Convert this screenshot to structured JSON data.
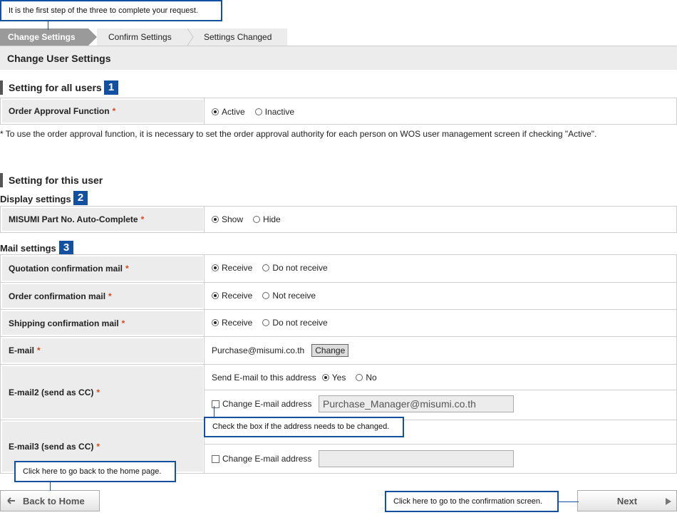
{
  "callouts": {
    "step": "It is the first step of the three to complete your request.",
    "checkbox": "Check the box if the address needs to be changed.",
    "home": "Click here to go back to the home page.",
    "next": "Click here to go to the confirmation screen."
  },
  "steps": [
    "Change Settings",
    "Confirm Settings",
    "Settings Changed"
  ],
  "page_title": "Change User Settings",
  "sections": {
    "all_users": {
      "title": "Setting for all users",
      "num": "1"
    },
    "this_user": {
      "title": "Setting for this user"
    },
    "display": {
      "title": "Display settings",
      "num": "2"
    },
    "mail": {
      "title": "Mail settings",
      "num": "3"
    }
  },
  "required_mark": "*",
  "order_approval": {
    "label": "Order Approval Function",
    "opt1": "Active",
    "opt2": "Inactive"
  },
  "note": "* To use the order approval function, it is necessary to set the order approval authority for each person on WOS user management screen if checking \"Active\".",
  "autocomplete": {
    "label": "MISUMI Part No. Auto-Complete",
    "opt1": "Show",
    "opt2": "Hide"
  },
  "quotation_mail": {
    "label": "Quotation confirmation mail",
    "opt1": "Receive",
    "opt2": "Do not receive"
  },
  "order_mail": {
    "label": "Order confirmation mail",
    "opt1": "Receive",
    "opt2": "Not receive"
  },
  "shipping_mail": {
    "label": "Shipping confirmation mail",
    "opt1": "Receive",
    "opt2": "Do not receive"
  },
  "email": {
    "label": "E-mail",
    "value": "Purchase@misumi.co.th",
    "button": "Change"
  },
  "email2": {
    "label": "E-mail2 (send as CC)",
    "send_label": "Send E-mail to this address",
    "opt1": "Yes",
    "opt2": "No",
    "change_label": "Change E-mail address",
    "value": "Purchase_Manager@misumi.co.th"
  },
  "email3": {
    "label": "E-mail3 (send as CC)",
    "change_label": "Change E-mail address",
    "value": ""
  },
  "buttons": {
    "back": "Back to Home",
    "next": "Next"
  }
}
